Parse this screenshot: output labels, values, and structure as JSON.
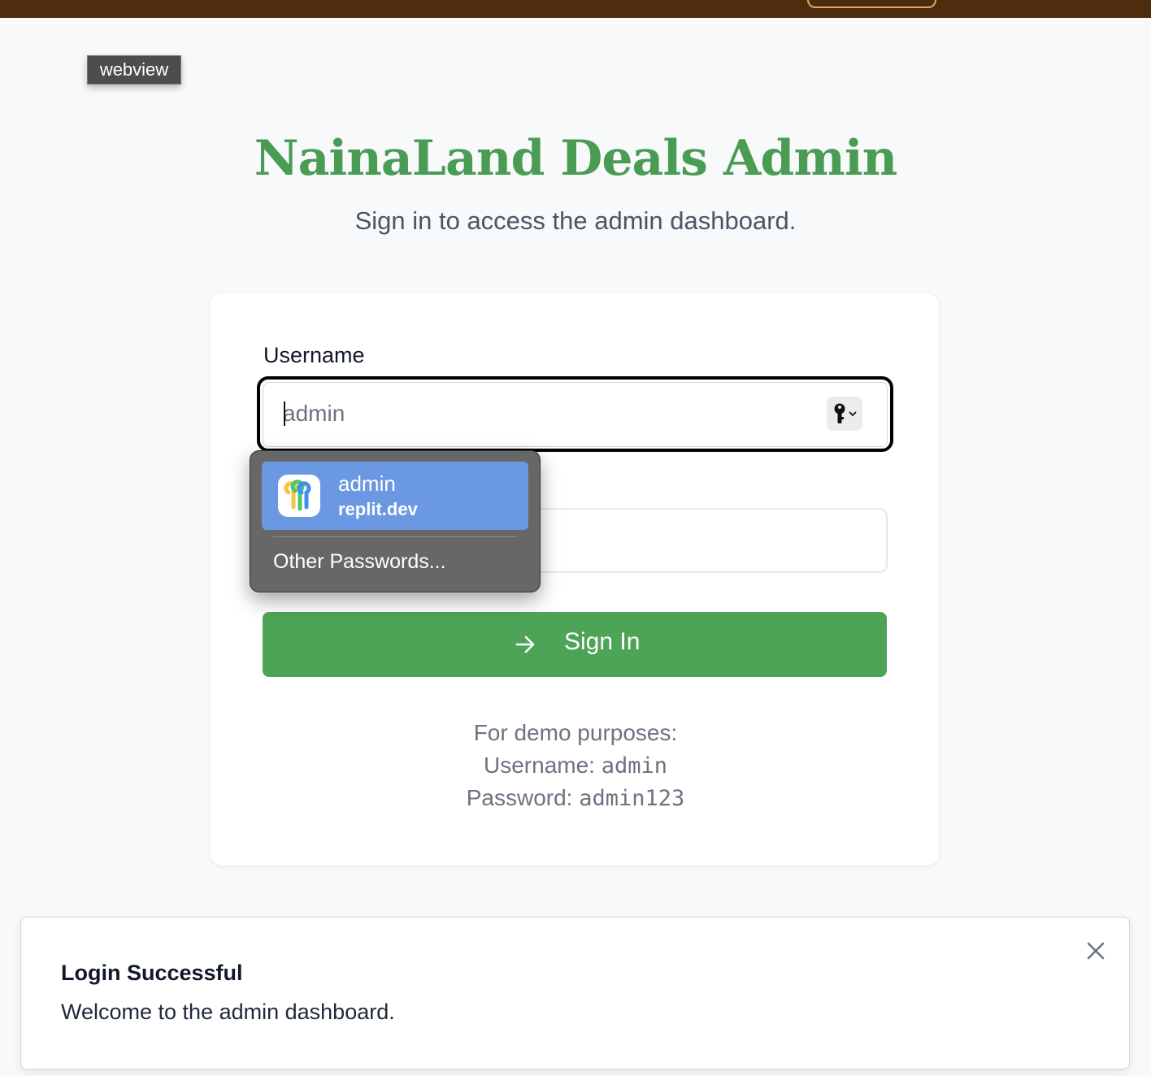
{
  "overlay": {
    "webview_label": "webview"
  },
  "header": {
    "title": "NainaLand Deals Admin",
    "subtitle": "Sign in to access the admin dashboard."
  },
  "form": {
    "username_label": "Username",
    "username_value": "admin",
    "signin_label": "Sign In"
  },
  "autofill": {
    "account_user": "admin",
    "account_site": "replit.dev",
    "other_passwords": "Other Passwords..."
  },
  "demo": {
    "heading": "For demo purposes:",
    "username_prefix": "Username: ",
    "username": "admin",
    "password_prefix": "Password: ",
    "password": "admin123"
  },
  "toast": {
    "title": "Login Successful",
    "description": "Welcome to the admin dashboard."
  },
  "colors": {
    "brand_green": "#4ea456",
    "title_green": "#4a9c55",
    "topbar_brown": "#4e2c0e",
    "autofill_highlight": "#6a98e2"
  },
  "icons": [
    "key-icon",
    "chevron-down-icon",
    "passwords-app-icon",
    "arrow-right-icon",
    "close-icon"
  ]
}
